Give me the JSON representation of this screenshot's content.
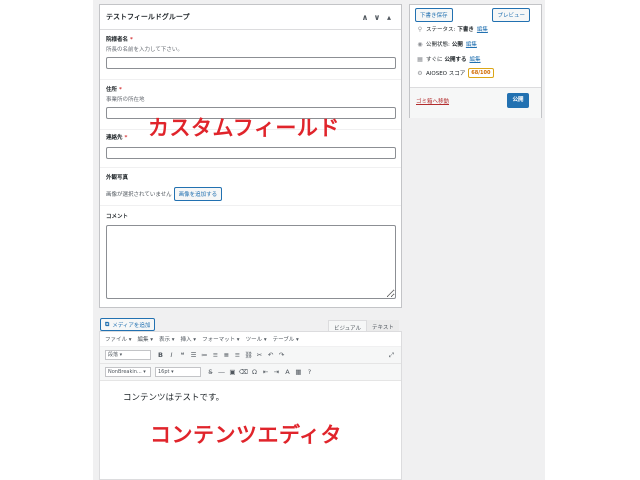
{
  "custom_fields": {
    "title": "テストフィールドグループ",
    "controls": {
      "up": "∧",
      "down": "∨",
      "toggle": "▴"
    },
    "fields": [
      {
        "label": "院様者名",
        "required": "*",
        "description": "所長の名前を入力して下さい。",
        "value": ""
      },
      {
        "label": "住所",
        "required": "*",
        "description": "事業所の所在地",
        "value": ""
      },
      {
        "label": "連絡先",
        "required": "*",
        "description": "",
        "value": ""
      }
    ],
    "image_field": {
      "label": "外観写真",
      "no_image_text": "画像が選択されていません",
      "add_button": "画像を追加する"
    },
    "comment_field": {
      "label": "コメント",
      "value": ""
    }
  },
  "annotations": {
    "custom_field": "カスタムフィールド",
    "content_editor": "コンテンツエディタ"
  },
  "publish": {
    "save_draft": "下書き保存",
    "preview": "プレビュー",
    "status_label": "ステータス:",
    "status_value": "下書き",
    "status_link": "編集",
    "visibility_label": "公開状態:",
    "visibility_value": "公開",
    "visibility_link": "編集",
    "schedule_label": "すぐに",
    "schedule_value": "公開する",
    "schedule_link": "編集",
    "seo_label": "AIOSEO スコア",
    "seo_score": "68/100",
    "trash_link": "ゴミ箱へ移動",
    "publish_button": "公開"
  },
  "editor": {
    "add_media": "メディアを追加",
    "tab_visual": "ビジュアル",
    "tab_text": "テキスト",
    "menu": [
      "ファイル ▾",
      "編集 ▾",
      "表示 ▾",
      "挿入 ▾",
      "フォーマット ▾",
      "ツール ▾",
      "テーブル ▾"
    ],
    "format_select": "段落",
    "font_select": "NonBreakin...",
    "size_select": "16pt",
    "content": "コンテンツはテストです。"
  },
  "colors": {
    "accent": "#2271b1",
    "annotation": "#e0242b",
    "score": "#d16b00"
  }
}
